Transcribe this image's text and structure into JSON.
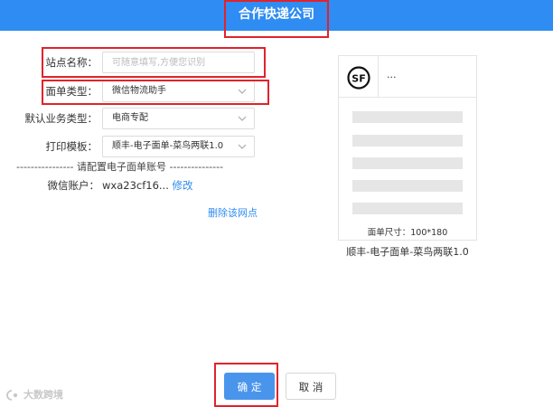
{
  "header": {
    "title": "合作快递公司"
  },
  "form": {
    "site_name": {
      "label": "站点名称：",
      "placeholder": "可随意填写,方便您识别",
      "value": ""
    },
    "waybill_type": {
      "label": "面单类型：",
      "value": "微信物流助手"
    },
    "business_type": {
      "label": "默认业务类型：",
      "value": "电商专配"
    },
    "print_template": {
      "label": "打印模板：",
      "value": "顺丰-电子面单-菜鸟两联1.0"
    },
    "divider_text": "---------------- 请配置电子面单账号 ---------------",
    "wechat_account": {
      "label": "微信账户：",
      "value": "wxa23cf16...",
      "edit_label": "修改"
    },
    "delete_link": "删除该网点"
  },
  "preview": {
    "logo_text": "SF",
    "header_placeholder": "...",
    "size_text": "面单尺寸：100*180",
    "template_name": "顺丰-电子面单-菜鸟两联1.0"
  },
  "footer": {
    "confirm_label": "确 定",
    "cancel_label": "取 消"
  },
  "watermark": {
    "text": "大数跨境"
  },
  "colors": {
    "header_bg": "#2f8cf2",
    "link": "#2f8cf2",
    "primary_button": "#4a95ec",
    "highlight_border": "#e0232b"
  },
  "icons": {
    "select_arrow": "chevron-down-icon",
    "courier_logo": "sf-express-logo",
    "watermark_logo": "watermark-logo-icon"
  }
}
